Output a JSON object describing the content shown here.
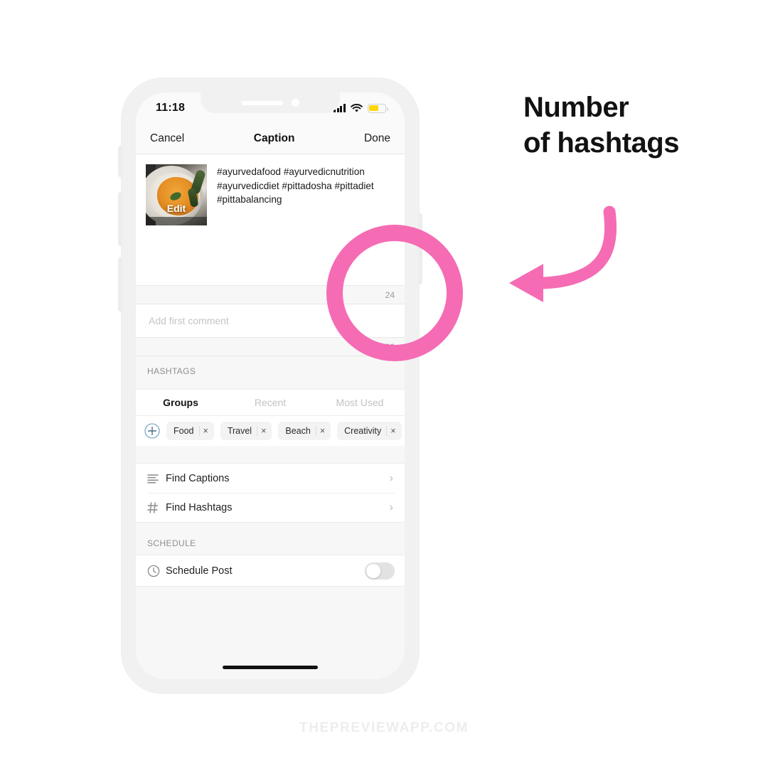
{
  "annotation": {
    "heading_line1": "Number",
    "heading_line2": "of hashtags",
    "circle_color": "#f56cb4",
    "arrow_color": "#f56cb4"
  },
  "watermark": {
    "text": "THEPREVIEWAPP.COM"
  },
  "phone": {
    "status_bar": {
      "time": "11:18",
      "signal_icon": "cellular-bars-icon",
      "wifi_icon": "wifi-icon",
      "battery_icon": "battery-low-icon",
      "battery_color": "#ffd60a"
    },
    "nav": {
      "cancel_label": "Cancel",
      "title": "Caption",
      "done_label": "Done"
    },
    "caption": {
      "thumbnail_edit_label": "Edit",
      "text": "#ayurvedafood #ayurvedicnutrition #ayurvedicdiet #pittadosha #pittadiet #pittabalancing",
      "caption_hashtag_count": "24"
    },
    "comment": {
      "placeholder": "Add first comment",
      "comment_hashtag_count": "30"
    },
    "hashtags_section": {
      "label": "HASHTAGS",
      "tabs": [
        {
          "label": "Groups",
          "active": true
        },
        {
          "label": "Recent",
          "active": false
        },
        {
          "label": "Most Used",
          "active": false
        }
      ],
      "add_icon": "plus-circle-icon",
      "chips": [
        {
          "label": "Food",
          "remove": "×"
        },
        {
          "label": "Travel",
          "remove": "×"
        },
        {
          "label": "Beach",
          "remove": "×"
        },
        {
          "label": "Creativity",
          "remove": "×"
        }
      ]
    },
    "menu": [
      {
        "label": "Find Captions",
        "icon": "list-lines-icon",
        "chevron": "›"
      },
      {
        "label": "Find Hashtags",
        "icon": "hash-icon",
        "chevron": "›"
      }
    ],
    "schedule": {
      "label": "SCHEDULE",
      "row_label": "Schedule Post",
      "icon": "clock-icon",
      "toggle_state": "off"
    }
  }
}
